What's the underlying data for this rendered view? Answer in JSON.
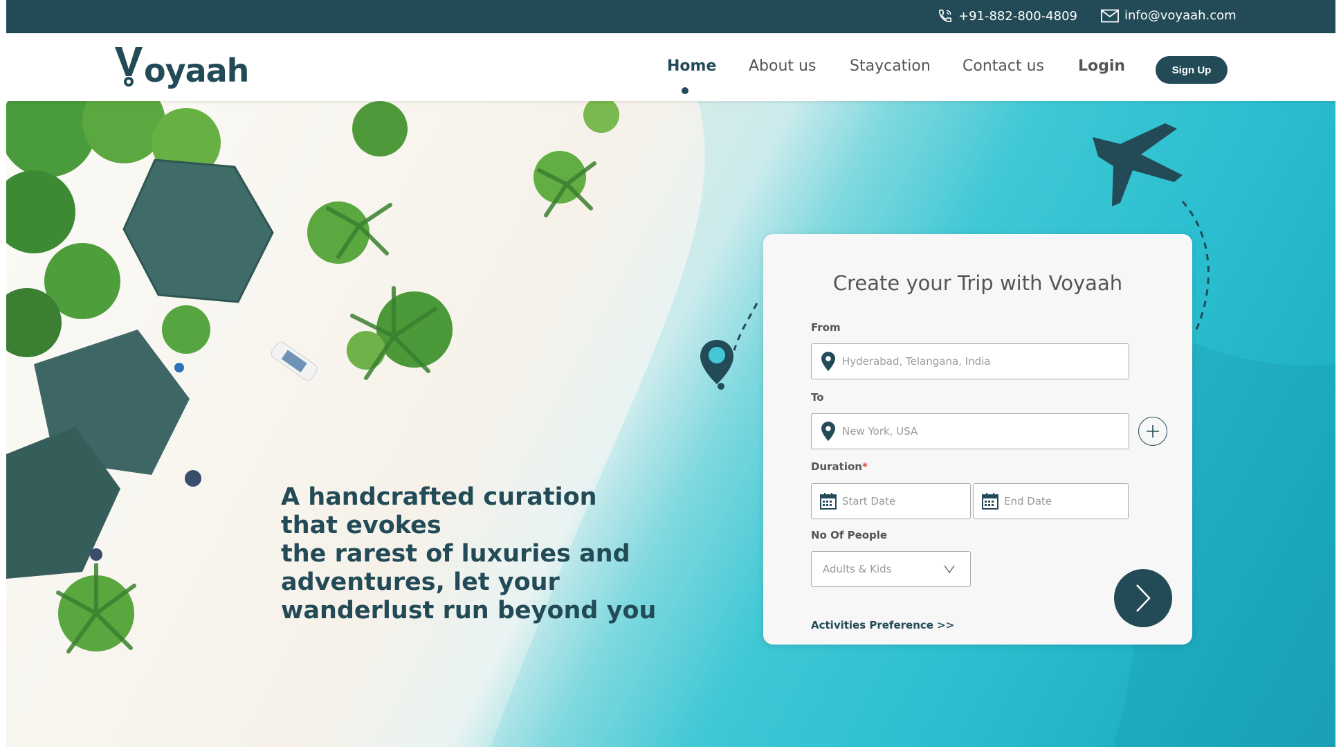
{
  "topbar": {
    "phone": "+91-882-800-4809",
    "email": "info@voyaah.com",
    "phone_icon": "phone-icon",
    "mail_icon": "mail-icon"
  },
  "brand": {
    "logo_text": "Voyaah"
  },
  "nav": {
    "items": [
      {
        "label": "Home",
        "active": true
      },
      {
        "label": "About us"
      },
      {
        "label": "Staycation"
      },
      {
        "label": "Contact us"
      },
      {
        "label": "Login"
      }
    ],
    "signup_label": "Sign Up"
  },
  "hero": {
    "headline_lines": [
      "A handcrafted curation",
      "that evokes",
      "the rarest of luxuries and",
      "adventures, let your",
      "wanderlust run beyond you"
    ]
  },
  "trip_form": {
    "title": "Create your Trip with Voyaah",
    "from_label": "From",
    "from_placeholder": "Hyderabad, Telangana, India",
    "to_label": "To",
    "to_placeholder": "New York, USA",
    "duration_label": "Duration",
    "duration_required_mark": "*",
    "start_placeholder": "Start Date",
    "end_placeholder": "End Date",
    "people_label": "No Of People",
    "people_placeholder": "Adults & Kids",
    "activities_link": "Activities Preference >>"
  },
  "colors": {
    "brand": "#234b57",
    "accent_required": "#d9534f",
    "sea": "#2bbfd0",
    "sand": "#f6f2ea"
  }
}
